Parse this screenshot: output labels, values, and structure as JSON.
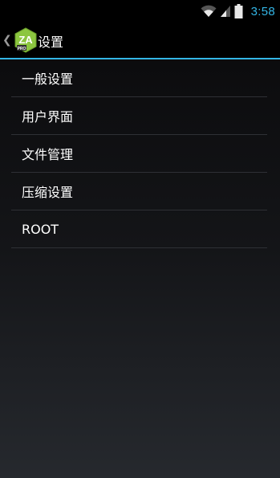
{
  "status_bar": {
    "time": "3:58",
    "icons": [
      "wifi-icon",
      "signal-icon",
      "battery-icon"
    ]
  },
  "action_bar": {
    "title": "设置",
    "app_icon": "zarchiver-pro-icon",
    "logo_text": "ZA",
    "logo_sub": "PRO"
  },
  "menu": {
    "items": [
      {
        "label": "一般设置"
      },
      {
        "label": "用户界面"
      },
      {
        "label": "文件管理"
      },
      {
        "label": "压缩设置"
      },
      {
        "label": "ROOT"
      }
    ]
  },
  "colors": {
    "accent": "#33b5e5",
    "logo_green": "#8cc63f",
    "text": "#ffffff"
  }
}
